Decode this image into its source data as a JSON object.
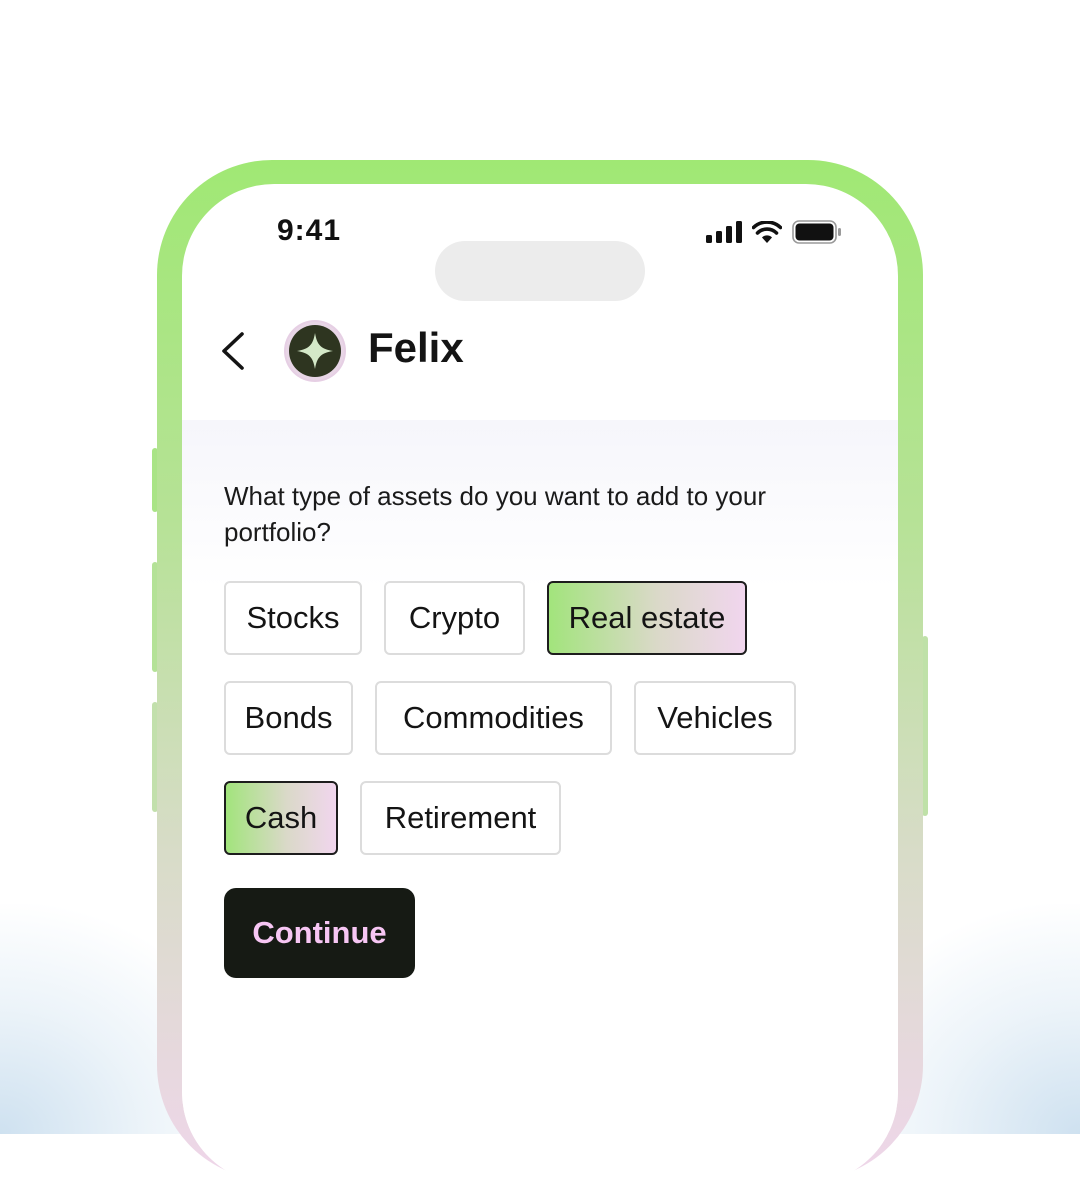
{
  "status_bar": {
    "time": "9:41"
  },
  "header": {
    "contact_name": "Felix"
  },
  "chat": {
    "question": "What type of assets do you want to add to your portfolio?",
    "chips": [
      {
        "label": "Stocks",
        "selected": false
      },
      {
        "label": "Crypto",
        "selected": false
      },
      {
        "label": "Real estate",
        "selected": true
      },
      {
        "label": "Bonds",
        "selected": false
      },
      {
        "label": "Commodities",
        "selected": false
      },
      {
        "label": "Vehicles",
        "selected": false
      },
      {
        "label": "Cash",
        "selected": true
      },
      {
        "label": "Retirement",
        "selected": false
      }
    ],
    "continue_label": "Continue"
  },
  "colors": {
    "frame_top": "#a0e874",
    "frame_bottom": "#efd6ea",
    "selected_gradient_start": "#a2e47c",
    "selected_gradient_end": "#f1d6ee",
    "continue_bg": "#161a14",
    "continue_text": "#f7c6f4"
  },
  "icons": [
    "cellular-signal-icon",
    "wifi-icon",
    "battery-icon",
    "back-chevron-icon",
    "sparkle-avatar-icon"
  ]
}
